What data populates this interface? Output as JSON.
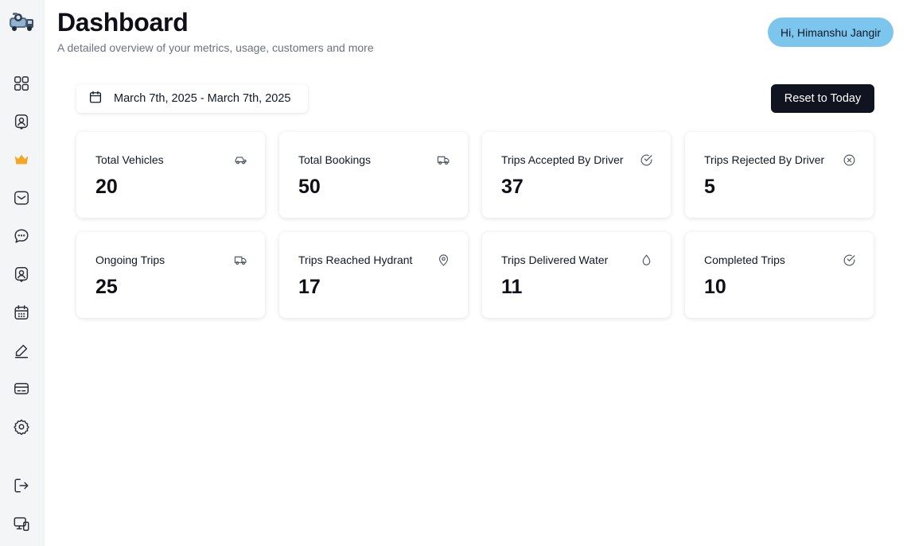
{
  "header": {
    "title": "Dashboard",
    "subtitle": "A detailed overview of your metrics, usage, customers and more",
    "greeting": "Hi, Himanshu Jangir"
  },
  "sidebar": {
    "items": [
      {
        "icon": "grid-icon"
      },
      {
        "icon": "user-badge-icon"
      },
      {
        "icon": "crown-icon"
      },
      {
        "icon": "mail-icon"
      },
      {
        "icon": "chat-icon"
      },
      {
        "icon": "user-badge-icon"
      },
      {
        "icon": "calendar-icon"
      },
      {
        "icon": "edit-icon"
      },
      {
        "icon": "card-icon"
      },
      {
        "icon": "settings-icon"
      },
      {
        "icon": "logout-icon"
      },
      {
        "icon": "devices-icon"
      }
    ],
    "accent_color": "#f5a623"
  },
  "toolbar": {
    "date_range": "March 7th, 2025 - March 7th, 2025",
    "reset_label": "Reset to Today"
  },
  "cards": [
    {
      "label": "Total Vehicles",
      "value": "20",
      "icon": "car-icon"
    },
    {
      "label": "Total Bookings",
      "value": "50",
      "icon": "truck-icon"
    },
    {
      "label": "Trips Accepted By Driver",
      "value": "37",
      "icon": "check-circle-icon"
    },
    {
      "label": "Trips Rejected By Driver",
      "value": "5",
      "icon": "x-circle-icon"
    },
    {
      "label": "Ongoing Trips",
      "value": "25",
      "icon": "truck-icon"
    },
    {
      "label": "Trips Reached Hydrant",
      "value": "17",
      "icon": "map-pin-icon"
    },
    {
      "label": "Trips Delivered Water",
      "value": "11",
      "icon": "droplet-icon"
    },
    {
      "label": "Completed Trips",
      "value": "10",
      "icon": "check-circle-icon"
    }
  ],
  "colors": {
    "greeting_bg": "#7cc5ec",
    "primary_button": "#0f1420"
  }
}
